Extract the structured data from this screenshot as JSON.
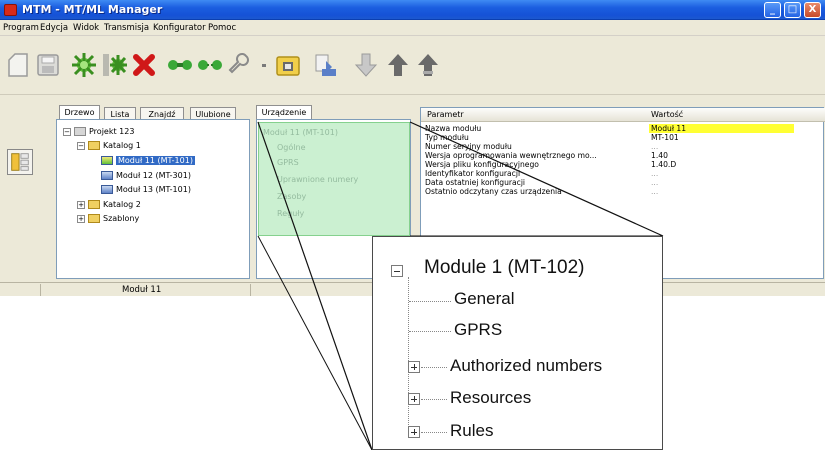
{
  "window": {
    "title": "MTM - MT/ML Manager",
    "buttons": {
      "minimize": "_",
      "maximize": "□",
      "close": "X"
    }
  },
  "menu": [
    "Program",
    "Edycja",
    "Widok",
    "Transmisja",
    "Konfigurator",
    "Pomoc"
  ],
  "toolbar_icons": [
    "new-icon",
    "save-icon",
    "add-module-icon",
    "add-module-split-icon",
    "delete-icon",
    "connect-icon",
    "disconnect-icon",
    "key-icon",
    "dropdown-arrow-icon",
    "config-icon",
    "read-config-icon",
    "download-icon",
    "upload-icon",
    "upload-all-icon"
  ],
  "tabs": {
    "tree": "Drzewo",
    "list": "Lista",
    "find": "Znajdź",
    "favorites": "Ulubione",
    "device": "Urządzenie"
  },
  "tree": {
    "project": "Projekt 123",
    "catalog1": "Katalog 1",
    "module11": "Moduł 11 (MT-101)",
    "module12": "Moduł 12 (MT-301)",
    "module13": "Moduł 13 (MT-101)",
    "catalog2": "Katalog 2",
    "templates": "Szablony",
    "expand": "+",
    "collapse": "−"
  },
  "device_tree": {
    "root": "Moduł 11 (MT-101)",
    "general": "Ogólne",
    "gprs": "GPRS",
    "authorized": "Uprawnione numery",
    "resources": "Zasoby",
    "rules": "Reguły"
  },
  "properties": {
    "header_param": "Parametr",
    "header_value": "Wartość",
    "rows": [
      {
        "name": "Nazwa modułu",
        "value": "Moduł 11"
      },
      {
        "name": "Typ modułu",
        "value": "MT-101"
      },
      {
        "name": "Numer seryjny modułu",
        "value": "..."
      },
      {
        "name": "Wersja oprogramowania wewnętrznego mo...",
        "value": "1.40"
      },
      {
        "name": "Wersja pliku konfiguracyjnego",
        "value": "1.40.D"
      },
      {
        "name": "Identyfikator konfiguracji",
        "value": "..."
      },
      {
        "name": "Data ostatniej konfiguracji",
        "value": "..."
      },
      {
        "name": "Ostatnio odczytany czas urządzenia",
        "value": "..."
      }
    ]
  },
  "status": {
    "text": "Moduł 11"
  },
  "zoom": {
    "root": "Module 1 (MT-102)",
    "general": "General",
    "gprs": "GPRS",
    "authorized": "Authorized numbers",
    "resources": "Resources",
    "rules": "Rules"
  },
  "colors": {
    "titlebar": "#1b5ee0",
    "selection": "#316ac5",
    "highlight_value": "#ffff33",
    "device_overlay": "#c9f0cf"
  }
}
